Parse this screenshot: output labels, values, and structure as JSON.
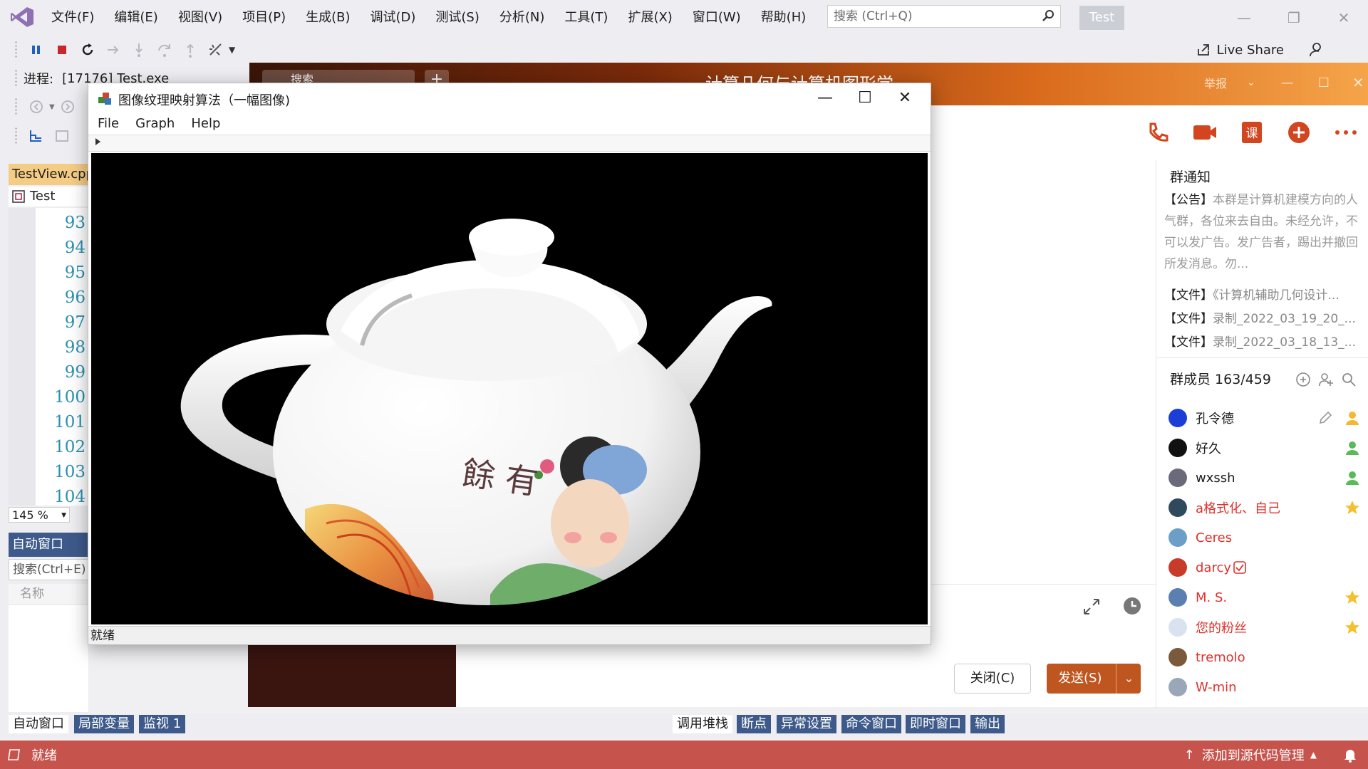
{
  "vs": {
    "menu": [
      "文件(F)",
      "编辑(E)",
      "视图(V)",
      "项目(P)",
      "生成(B)",
      "调试(D)",
      "测试(S)",
      "分析(N)",
      "工具(T)",
      "扩展(X)",
      "窗口(W)",
      "帮助(H)"
    ],
    "search_placeholder": "搜索 (Ctrl+Q)",
    "solution_name": "Test",
    "live_share": "Live Share",
    "process_label": "进程:",
    "process_value": "[17176] Test.exe",
    "doc_tab": "TestView.cpp",
    "nav_combo": "Test",
    "line_numbers": [
      "93",
      "94",
      "95",
      "96",
      "97",
      "98",
      "99",
      "100",
      "101",
      "102",
      "103",
      "104"
    ],
    "zoom": "145 %",
    "auto_window_title": "自动窗口",
    "auto_search": "搜索(Ctrl+E)",
    "auto_col_name": "名称",
    "bottom_tabs_left": [
      "自动窗口",
      "局部变量",
      "监视 1"
    ],
    "bottom_tabs_right": [
      "调用堆栈",
      "断点",
      "异常设置",
      "命令窗口",
      "即时窗口",
      "输出"
    ],
    "status_ready": "就绪",
    "status_source_control": "添加到源代码管理"
  },
  "qq": {
    "search_placeholder": "搜索",
    "title": "计算几何与计算机图形学",
    "report": "举报",
    "notice_title": "群通知",
    "notice_tag": "【公告】",
    "notice_text": "本群是计算机建模方向的人气群，各位来去自由。未经允许，不可以发广告。发广告者，踢出并撤回所发消息。勿...",
    "files": [
      {
        "tag": "【文件】",
        "name": "《计算机辅助几何设计..."
      },
      {
        "tag": "【文件】",
        "name": "录制_2022_03_19_20_..."
      },
      {
        "tag": "【文件】",
        "name": "录制_2022_03_18_13_..."
      }
    ],
    "members_title": "群成员 163/459",
    "members": [
      {
        "name": "孔令德",
        "color": "#1e1e1e",
        "avatar": "#1b3fd6",
        "badge": "owner-icon"
      },
      {
        "name": "好久",
        "color": "#1e1e1e",
        "avatar": "#111111",
        "badge": "admin-icon"
      },
      {
        "name": "wxssh",
        "color": "#1e1e1e",
        "avatar": "#6a6a7a",
        "badge": "admin-icon"
      },
      {
        "name": "a格式化、自己",
        "color": "#e0302a",
        "avatar": "#2f4a5c",
        "badge": "star-icon"
      },
      {
        "name": "Ceres",
        "color": "#e0302a",
        "avatar": "#6b9fc8",
        "badge": ""
      },
      {
        "name": "darcy",
        "color": "#e0302a",
        "avatar": "#c83a2a",
        "badge": ""
      },
      {
        "name": "M. S.",
        "color": "#e0302a",
        "avatar": "#5a7fb0",
        "badge": "star-icon"
      },
      {
        "name": "您的粉丝",
        "color": "#e0302a",
        "avatar": "#d9e3ef",
        "badge": "star-icon"
      },
      {
        "name": "tremolo",
        "color": "#e0302a",
        "avatar": "#7a5a3a",
        "badge": ""
      },
      {
        "name": "W-min",
        "color": "#e0302a",
        "avatar": "#9aa7b8",
        "badge": ""
      }
    ],
    "close_button": "关闭(C)",
    "send_button": "发送(S)"
  },
  "app": {
    "title": "图像纹理映射算法（一幅图像)",
    "menu": [
      "File",
      "Graph",
      "Help"
    ],
    "status": "就绪",
    "teapot_text": "餘 有"
  },
  "colors": {
    "vs_accent": "#3d5a8a",
    "status_bar": "#c6534c",
    "doc_tab": "#f5cc84",
    "qq_send": "#c0561f"
  }
}
